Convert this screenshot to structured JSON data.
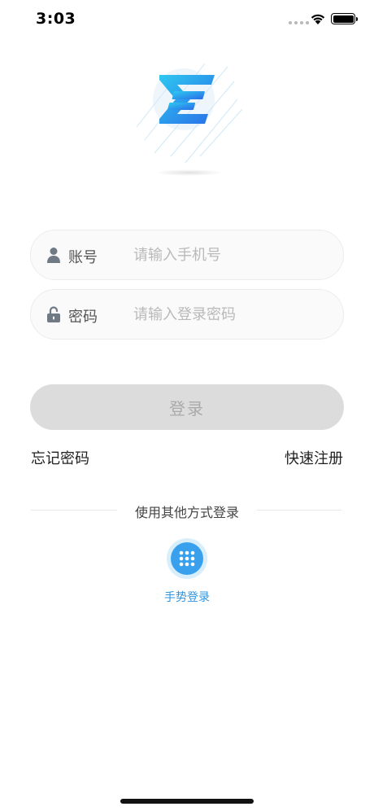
{
  "status_bar": {
    "time": "3:03"
  },
  "login_form": {
    "account": {
      "label": "账号",
      "placeholder": "请输入手机号",
      "icon": "person-icon"
    },
    "password": {
      "label": "密码",
      "placeholder": "请输入登录密码",
      "icon": "unlocked-padlock-icon"
    },
    "submit_label": "登录"
  },
  "links": {
    "forgot_password": "忘记密码",
    "quick_register": "快速注册"
  },
  "other_login": {
    "divider_text": "使用其他方式登录",
    "gesture_label": "手势登录",
    "gesture_icon": "keypad-dots-icon"
  },
  "colors": {
    "accent_blue": "#39a0ee",
    "logo_cyan": "#2ec8f0",
    "logo_blue": "#2a6ee8",
    "button_disabled": "#dcdcdc"
  }
}
